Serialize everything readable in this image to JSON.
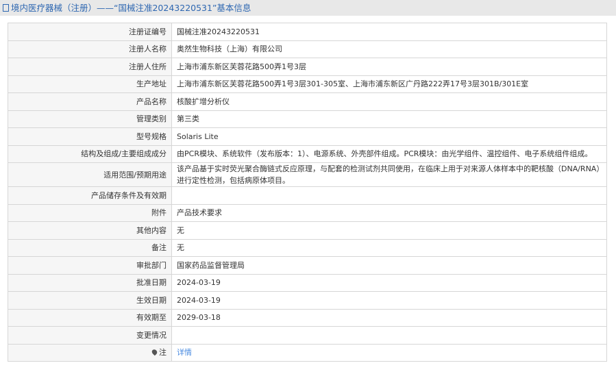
{
  "header": {
    "title": "境内医疗器械（注册）——“国械注准20243220531”基本信息"
  },
  "rows": [
    {
      "label": "注册证编号",
      "value": "国械注准20243220531"
    },
    {
      "label": "注册人名称",
      "value": "奥然生物科技（上海）有限公司"
    },
    {
      "label": "注册人住所",
      "value": "上海市浦东新区芙蓉花路500弄1号3层"
    },
    {
      "label": "生产地址",
      "value": "上海市浦东新区芙蓉花路500弄1号3层301-305室、上海市浦东新区广丹路222弄17号3层301B/301E室"
    },
    {
      "label": "产品名称",
      "value": "核酸扩增分析仪"
    },
    {
      "label": "管理类别",
      "value": "第三类"
    },
    {
      "label": "型号规格",
      "value": "Solaris Lite"
    },
    {
      "label": "结构及组成/主要组成成分",
      "value": "由PCR模块、系统软件（发布版本：1）、电源系统、外壳部件组成。PCR模块：由光学组件、温控组件、电子系统组件组成。"
    },
    {
      "label": "适用范围/预期用途",
      "value": "该产品基于实时荧光聚合酶链式反应原理，与配套的检测试剂共同使用，在临床上用于对来源人体样本中的靶核酸（DNA/RNA）进行定性检测，包括病原体项目。"
    },
    {
      "label": "产品储存条件及有效期",
      "value": ""
    },
    {
      "label": "附件",
      "value": "产品技术要求"
    },
    {
      "label": "其他内容",
      "value": "无"
    },
    {
      "label": "备注",
      "value": "无"
    },
    {
      "label": "审批部门",
      "value": "国家药品监督管理局"
    },
    {
      "label": "批准日期",
      "value": "2024-03-19"
    },
    {
      "label": "生效日期",
      "value": "2024-03-19"
    },
    {
      "label": "有效期至",
      "value": "2029-03-18"
    },
    {
      "label": "变更情况",
      "value": ""
    }
  ],
  "note": {
    "label": "注",
    "link": "详情"
  }
}
